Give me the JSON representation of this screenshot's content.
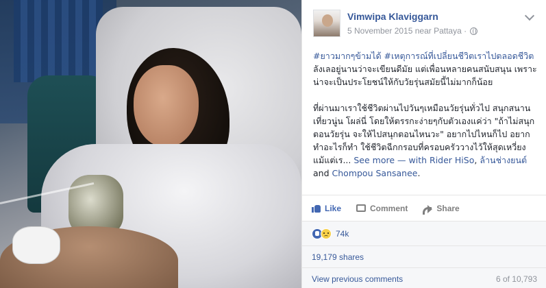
{
  "post": {
    "author": "Vimwipa Klaviggarn",
    "meta": "5 November 2015 near Pattaya ·",
    "hashtags": "#ยาวมากๆข้ามได้ #เหตุการณ์ที่เปลี่ยนชีวิตเราไปตลอดชีวิต",
    "paragraph1": "ลังเลอยู่นานว่าจะเขียนดีมัย แต่เพื่อนหลายคนสนับสนุน เพราะน่าจะเป็นประโยชน์ให้กับวัยรุ่นสมัยนี้ไม่มากก็น้อย",
    "paragraph2": "ที่ผ่านมาเราใช้ชีวิตผ่านไปวันๆเหมือนวัยรุ่นทั่วไป สนุกสนาน เที่ยวนู่น โผล่นี่ โดยให้ตรรกะง่ายๆกับตัวเองแค่ว่า \"ถ้าไม่สนุกตอนวัยรุ่น จะให้ไปสนุกตอนไหนวะ\" อยากไปไหนก็ไป อยากทำอะไรก็ทำ ใช้ชีวิตฉีกกรอบที่ครอบครัววางไว้ให้สุดเหวี่ยง แม้แต่เร...",
    "see_more": "See more",
    "with_prefix": "— with",
    "tag1": "Rider HiSo",
    "tag_sep": ",",
    "tag2": "ล้านช่างยนต์",
    "and_text": "and",
    "tag3": "Chompou Sansanee",
    "tag_end": "."
  },
  "actions": {
    "like": "Like",
    "comment": "Comment",
    "share": "Share"
  },
  "reactions": {
    "count": "74k"
  },
  "shares": "19,179 shares",
  "comments": {
    "view_previous": "View previous comments",
    "count": "6 of 10,793"
  },
  "colors": {
    "link": "#365899",
    "like_blue": "#4267b2",
    "muted": "#90949c"
  },
  "icons": [
    "globe-icon",
    "chevron-down-icon",
    "like-icon",
    "comment-icon",
    "share-icon",
    "like-reaction-icon",
    "sad-reaction-icon"
  ]
}
